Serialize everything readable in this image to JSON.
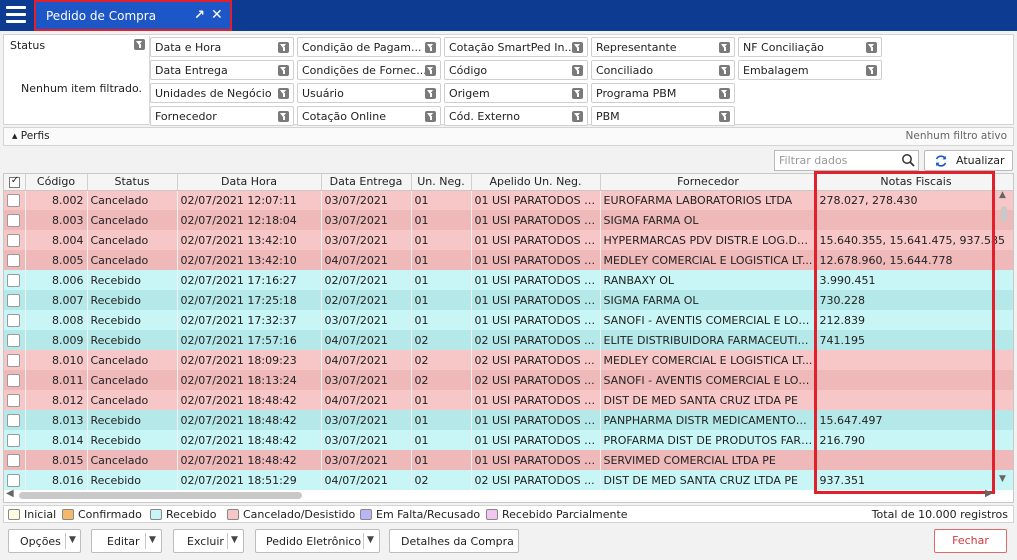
{
  "header": {
    "tab_title": "Pedido de Compra",
    "popout_glyph": "↗",
    "close_glyph": "✕"
  },
  "filters": {
    "status_label": "Status",
    "status_message": "Nenhum item filtrado.",
    "items": [
      "Data e Hora",
      "Condição de Pagam...",
      "Cotação SmartPed In...",
      "Representante",
      "NF Conciliação",
      "Data Entrega",
      "Condições de Fornec...",
      "Código",
      "Conciliado",
      "Embalagem",
      "Unidades de Negócio",
      "Usuário",
      "Origem",
      "Programa PBM",
      "Fornecedor",
      "Cotação Online",
      "Cód. Externo",
      "PBM"
    ]
  },
  "perfis": {
    "label": "Perfis",
    "toggle_glyph": "▲",
    "status": "Nenhum filtro ativo"
  },
  "toolbar": {
    "search_placeholder": "Filtrar dados",
    "refresh_label": "Atualizar"
  },
  "grid": {
    "columns": [
      "Código",
      "Status",
      "Data Hora",
      "Data Entrega",
      "Un. Neg.",
      "Apelido Un. Neg.",
      "Fornecedor",
      "Notas Fiscais"
    ],
    "rows": [
      {
        "codigo": "8.002",
        "status": "Cancelado",
        "data_hora": "02/07/2021 12:07:11",
        "entrega": "03/07/2021",
        "un": "01",
        "apelido": "01 USI PARATODOS F...",
        "fornecedor": "EUROFARMA LABORATORIOS LTDA",
        "nf": "278.027, 278.430"
      },
      {
        "codigo": "8.003",
        "status": "Cancelado",
        "data_hora": "02/07/2021 12:18:04",
        "entrega": "03/07/2021",
        "un": "01",
        "apelido": "01 USI PARATODOS F...",
        "fornecedor": "SIGMA FARMA OL",
        "nf": ""
      },
      {
        "codigo": "8.004",
        "status": "Cancelado",
        "data_hora": "02/07/2021 13:42:10",
        "entrega": "03/07/2021",
        "un": "01",
        "apelido": "01 USI PARATODOS F...",
        "fornecedor": "HYPERMARCAS PDV DISTR.E LOG.DE ...",
        "nf": "15.640.355, 15.641.475, 937.585"
      },
      {
        "codigo": "8.005",
        "status": "Cancelado",
        "data_hora": "02/07/2021 13:42:10",
        "entrega": "04/07/2021",
        "un": "01",
        "apelido": "01 USI PARATODOS F...",
        "fornecedor": "MEDLEY COMERCIAL E LOGISTICA LT...",
        "nf": "12.678.960, 15.644.778"
      },
      {
        "codigo": "8.006",
        "status": "Recebido",
        "data_hora": "02/07/2021 17:16:27",
        "entrega": "02/07/2021",
        "un": "01",
        "apelido": "01 USI PARATODOS F...",
        "fornecedor": "RANBAXY OL",
        "nf": "3.990.451"
      },
      {
        "codigo": "8.007",
        "status": "Recebido",
        "data_hora": "02/07/2021 17:25:18",
        "entrega": "02/07/2021",
        "un": "01",
        "apelido": "01 USI PARATODOS F...",
        "fornecedor": "SIGMA FARMA OL",
        "nf": "730.228"
      },
      {
        "codigo": "8.008",
        "status": "Recebido",
        "data_hora": "02/07/2021 17:32:37",
        "entrega": "03/07/2021",
        "un": "01",
        "apelido": "01 USI PARATODOS F...",
        "fornecedor": "SANOFI - AVENTIS COMERCIAL E LOGI...",
        "nf": "212.839"
      },
      {
        "codigo": "8.009",
        "status": "Recebido",
        "data_hora": "02/07/2021 17:57:16",
        "entrega": "04/07/2021",
        "un": "02",
        "apelido": "02 USI PARATODOS ...",
        "fornecedor": "ELITE DISTRIBUIDORA FARMACEUTIC...",
        "nf": "741.195"
      },
      {
        "codigo": "8.010",
        "status": "Cancelado",
        "data_hora": "02/07/2021 18:09:23",
        "entrega": "04/07/2021",
        "un": "02",
        "apelido": "02 USI PARATODOS ...",
        "fornecedor": "MEDLEY COMERCIAL E LOGISTICA LT...",
        "nf": ""
      },
      {
        "codigo": "8.011",
        "status": "Cancelado",
        "data_hora": "02/07/2021 18:13:24",
        "entrega": "03/07/2021",
        "un": "02",
        "apelido": "02 USI PARATODOS ...",
        "fornecedor": "SANOFI - AVENTIS COMERCIAL E LOGI...",
        "nf": ""
      },
      {
        "codigo": "8.012",
        "status": "Cancelado",
        "data_hora": "02/07/2021 18:48:42",
        "entrega": "04/07/2021",
        "un": "01",
        "apelido": "01 USI PARATODOS F...",
        "fornecedor": "DIST DE MED SANTA CRUZ LTDA PE",
        "nf": ""
      },
      {
        "codigo": "8.013",
        "status": "Recebido",
        "data_hora": "02/07/2021 18:48:42",
        "entrega": "03/07/2021",
        "un": "01",
        "apelido": "01 USI PARATODOS F...",
        "fornecedor": "PANPHARMA DISTR MEDICAMENTOS ...",
        "nf": "15.647.497"
      },
      {
        "codigo": "8.014",
        "status": "Recebido",
        "data_hora": "02/07/2021 18:48:42",
        "entrega": "03/07/2021",
        "un": "01",
        "apelido": "01 USI PARATODOS F...",
        "fornecedor": "PROFARMA DIST DE PRODUTOS FARM...",
        "nf": "216.790"
      },
      {
        "codigo": "8.015",
        "status": "Cancelado",
        "data_hora": "02/07/2021 18:48:42",
        "entrega": "03/07/2021",
        "un": "01",
        "apelido": "01 USI PARATODOS F...",
        "fornecedor": "SERVIMED COMERCIAL LTDA PE",
        "nf": ""
      },
      {
        "codigo": "8.016",
        "status": "Recebido",
        "data_hora": "02/07/2021 18:51:29",
        "entrega": "04/07/2021",
        "un": "02",
        "apelido": "02 USI PARATODOS ...",
        "fornecedor": "DIST DE MED SANTA CRUZ LTDA PE",
        "nf": "937.351"
      }
    ]
  },
  "legend": {
    "items": [
      {
        "label": "Inicial",
        "color": "#fffbe0"
      },
      {
        "label": "Confirmado",
        "color": "#f6b86a"
      },
      {
        "label": "Recebido",
        "color": "#c8f5f5"
      },
      {
        "label": "Cancelado/Desistido",
        "color": "#f7c6c7"
      },
      {
        "label": "Em Falta/Recusado",
        "color": "#b9b4f2"
      },
      {
        "label": "Recebido Parcialmente",
        "color": "#f2c6f2"
      }
    ],
    "total": "Total de 10.000 registros"
  },
  "buttons": {
    "opcoes": "Opções",
    "editar": "Editar",
    "excluir": "Excluir",
    "pedido_eletronico": "Pedido Eletrônico",
    "detalhes": "Detalhes da Compra",
    "fechar": "Fechar",
    "dropdown_glyph": "▼"
  },
  "colors": {
    "topbar": "#0d3b91",
    "tab": "#1c56c7",
    "highlight": "#e0202a",
    "cancel_row": "#f7c6c7",
    "received_row": "#c8f5f5"
  }
}
